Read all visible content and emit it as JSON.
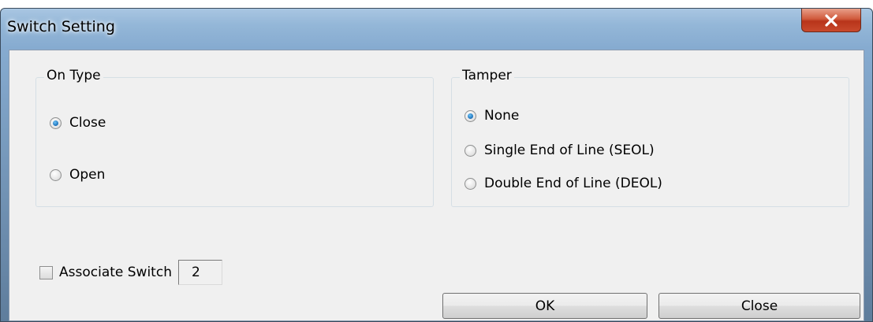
{
  "window": {
    "title": "Switch Setting",
    "close_icon": "close-x-icon"
  },
  "on_type": {
    "label": "On Type",
    "options": [
      {
        "label": "Close",
        "checked": true
      },
      {
        "label": "Open",
        "checked": false
      }
    ]
  },
  "tamper": {
    "label": "Tamper",
    "options": [
      {
        "label": "None",
        "checked": true
      },
      {
        "label": "Single End of Line (SEOL)",
        "checked": false
      },
      {
        "label": "Double End of Line (DEOL)",
        "checked": false
      }
    ]
  },
  "associate": {
    "label": "Associate Switch",
    "checked": false,
    "value": "2"
  },
  "buttons": {
    "ok": "OK",
    "close": "Close"
  },
  "colors": {
    "accent": "#1a6fb8",
    "close_button": "#c8492c"
  }
}
